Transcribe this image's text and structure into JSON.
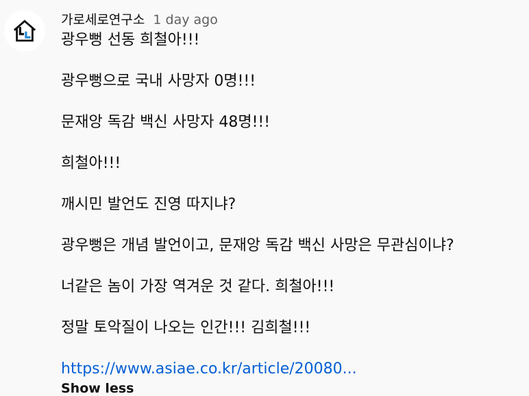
{
  "comment": {
    "author": "가로세로연구소",
    "timestamp": "1 day ago",
    "lines": [
      "광우뻥 선동 희철아!!!",
      "광우뻥으로 국내 사망자 0명!!!",
      "문재앙 독감 백신 사망자 48명!!!",
      "희철아!!!",
      "깨시민 발언도 진영 따지냐?",
      "광우뻥은 개념 발언이고, 문재앙 독감 백신 사망은 무관심이냐?",
      "너같은 놈이 가장 역겨운 것 같다. 희철아!!!",
      "정말 토악질이 나오는 인간!!! 김희철!!!"
    ],
    "link_text": "https://www.asiae.co.kr/article/20080...",
    "show_less_label": "Show less"
  },
  "colors": {
    "background": "#f9f9f9",
    "text": "#0f0f0f",
    "secondary_text": "#606060",
    "link": "#065fd4",
    "avatar_accent": "#2e8fd6"
  },
  "icons": {
    "avatar": "house-logo-icon"
  }
}
